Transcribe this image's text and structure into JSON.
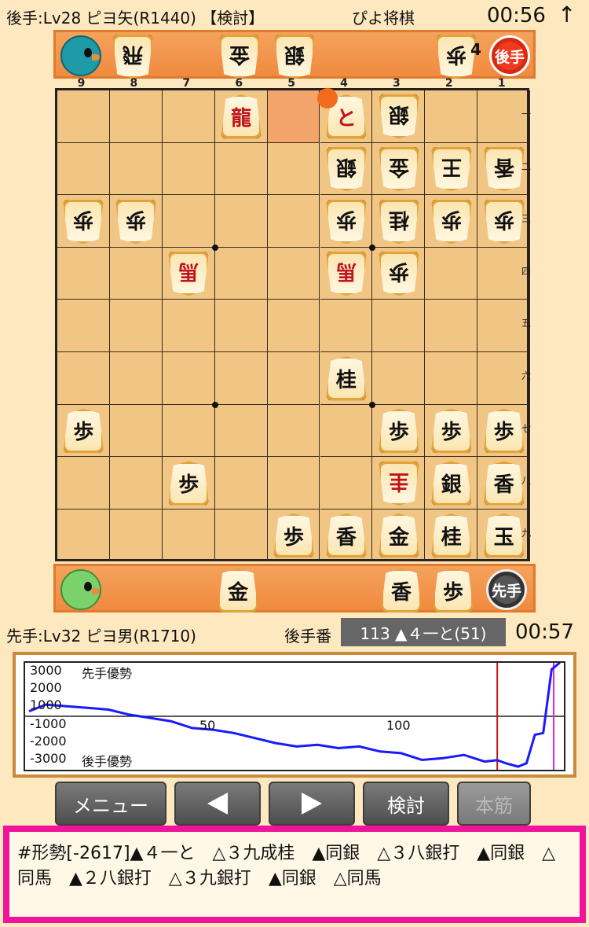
{
  "header": {
    "gote_player": "後手:Lv28 ピヨ矢(R1440) 【検討】",
    "app_title": "ぴよ将棋",
    "gote_clock": "00:56",
    "up_icon": "↑"
  },
  "gote_stand": {
    "badge": "後手",
    "pieces": [
      "飛",
      "金",
      "銀",
      "歩"
    ],
    "count": "4"
  },
  "file_numbers": [
    "9",
    "8",
    "7",
    "6",
    "5",
    "4",
    "3",
    "2",
    "1"
  ],
  "rank_numbers": [
    "一",
    "二",
    "三",
    "四",
    "五",
    "六",
    "七",
    "八",
    "九"
  ],
  "board": {
    "pieces": [
      {
        "ch": "龍",
        "file": 6,
        "rank": 1,
        "owner": "sente",
        "red": true
      },
      {
        "ch": "と",
        "file": 4,
        "rank": 1,
        "owner": "sente",
        "red": true
      },
      {
        "ch": "銀",
        "file": 3,
        "rank": 1,
        "owner": "gote",
        "red": false
      },
      {
        "ch": "銀",
        "file": 4,
        "rank": 2,
        "owner": "gote",
        "red": false
      },
      {
        "ch": "金",
        "file": 3,
        "rank": 2,
        "owner": "gote",
        "red": false
      },
      {
        "ch": "王",
        "file": 2,
        "rank": 2,
        "owner": "gote",
        "red": false
      },
      {
        "ch": "香",
        "file": 1,
        "rank": 2,
        "owner": "gote",
        "red": false
      },
      {
        "ch": "歩",
        "file": 9,
        "rank": 3,
        "owner": "gote",
        "red": false
      },
      {
        "ch": "歩",
        "file": 8,
        "rank": 3,
        "owner": "gote",
        "red": false
      },
      {
        "ch": "歩",
        "file": 4,
        "rank": 3,
        "owner": "gote",
        "red": false
      },
      {
        "ch": "桂",
        "file": 3,
        "rank": 3,
        "owner": "gote",
        "red": false
      },
      {
        "ch": "歩",
        "file": 2,
        "rank": 3,
        "owner": "gote",
        "red": false
      },
      {
        "ch": "歩",
        "file": 1,
        "rank": 3,
        "owner": "gote",
        "red": false
      },
      {
        "ch": "馬",
        "file": 7,
        "rank": 4,
        "owner": "gote",
        "red": true
      },
      {
        "ch": "馬",
        "file": 4,
        "rank": 4,
        "owner": "gote",
        "red": true
      },
      {
        "ch": "歩",
        "file": 3,
        "rank": 4,
        "owner": "gote",
        "red": false
      },
      {
        "ch": "桂",
        "file": 4,
        "rank": 6,
        "owner": "sente",
        "red": false
      },
      {
        "ch": "歩",
        "file": 9,
        "rank": 7,
        "owner": "sente",
        "red": false
      },
      {
        "ch": "歩",
        "file": 3,
        "rank": 7,
        "owner": "sente",
        "red": false
      },
      {
        "ch": "歩",
        "file": 2,
        "rank": 7,
        "owner": "sente",
        "red": false
      },
      {
        "ch": "歩",
        "file": 1,
        "rank": 7,
        "owner": "sente",
        "red": false
      },
      {
        "ch": "歩",
        "file": 7,
        "rank": 8,
        "owner": "sente",
        "red": false
      },
      {
        "ch": "圭",
        "file": 3,
        "rank": 8,
        "owner": "gote",
        "red": true
      },
      {
        "ch": "銀",
        "file": 2,
        "rank": 8,
        "owner": "sente",
        "red": false
      },
      {
        "ch": "香",
        "file": 1,
        "rank": 8,
        "owner": "sente",
        "red": false
      },
      {
        "ch": "歩",
        "file": 5,
        "rank": 9,
        "owner": "sente",
        "red": false
      },
      {
        "ch": "香",
        "file": 4,
        "rank": 9,
        "owner": "sente",
        "red": false
      },
      {
        "ch": "金",
        "file": 3,
        "rank": 9,
        "owner": "sente",
        "red": false
      },
      {
        "ch": "桂",
        "file": 2,
        "rank": 9,
        "owner": "sente",
        "red": false
      },
      {
        "ch": "玉",
        "file": 1,
        "rank": 9,
        "owner": "sente",
        "red": false
      }
    ]
  },
  "sente_stand": {
    "badge": "先手",
    "pieces": [
      "金",
      "香",
      "歩"
    ]
  },
  "status": {
    "sente_player": "先手:Lv32 ピヨ男(R1710)",
    "turn_label": "後手番",
    "current_move": "113 ▲４一と(51)",
    "sente_clock": "00:57"
  },
  "graph": {
    "labels": {
      "top": "3000",
      "y2000": "2000",
      "y1000": "1000",
      "ym1000": "-1000",
      "ym2000": "-2000",
      "bottom": "-3000",
      "sente_adv": "先手優勢",
      "gote_adv": "後手優勢",
      "x50": "50",
      "x100": "100"
    },
    "colors": {
      "line": "#1a1aff",
      "marker_red": "#d01515",
      "marker_magenta": "#e020e0"
    }
  },
  "chart_data": {
    "type": "line",
    "x": [
      1,
      5,
      10,
      15,
      20,
      25,
      30,
      35,
      40,
      45,
      50,
      55,
      60,
      65,
      70,
      75,
      80,
      85,
      90,
      95,
      100,
      105,
      110,
      113,
      115,
      118,
      120,
      122,
      124,
      126,
      128
    ],
    "series": [
      {
        "values": [
          300,
          700,
          600,
          500,
          400,
          100,
          -100,
          -300,
          -700,
          -800,
          -1000,
          -1300,
          -1600,
          -1800,
          -1700,
          -1900,
          -1800,
          -2100,
          -2200,
          -2600,
          -2500,
          -2300,
          -2700,
          -2617,
          -2800,
          -3000,
          -2800,
          -1100,
          -1000,
          2800,
          3200
        ]
      }
    ],
    "ylim": [
      -3000,
      3000
    ],
    "xlim": [
      1,
      128
    ]
  },
  "buttons": {
    "menu": "メニュー",
    "prev": "◀",
    "next": "▶",
    "analyze": "検討",
    "mainline": "本筋"
  },
  "analysis": {
    "text": "#形勢[-2617]▲４一と　△３九成桂　▲同銀　△３八銀打　▲同銀　△同馬　▲２八銀打　△３九銀打　▲同銀　△同馬"
  }
}
